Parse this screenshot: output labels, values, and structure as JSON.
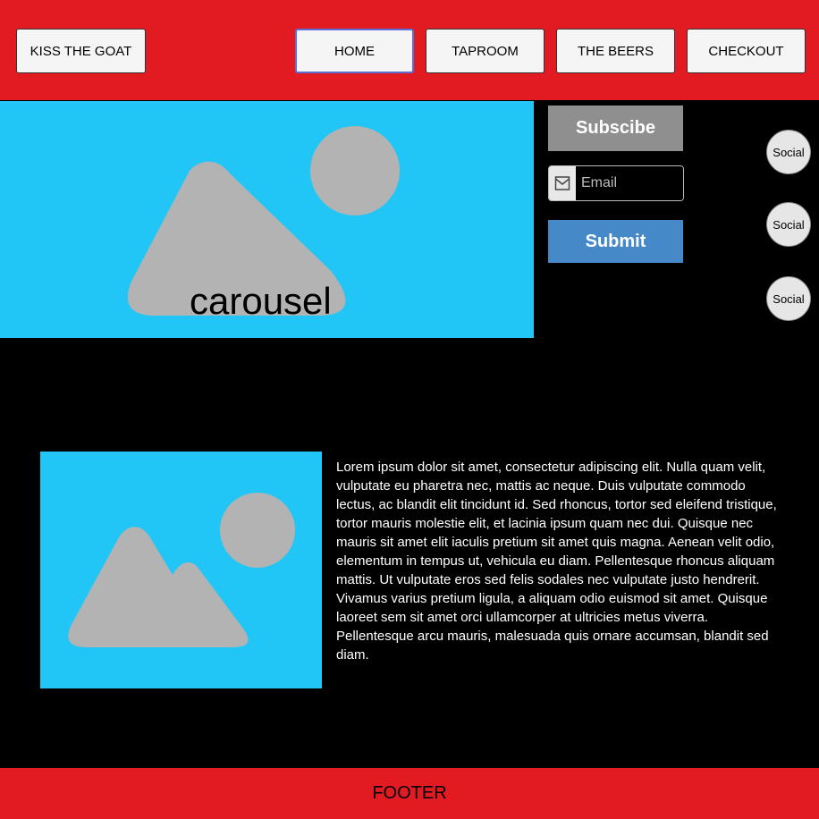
{
  "header": {
    "brand_label": "KISS THE GOAT",
    "nav": [
      {
        "label": "HOME"
      },
      {
        "label": "TAPROOM"
      },
      {
        "label": "THE BEERS"
      },
      {
        "label": "CHECKOUT"
      }
    ]
  },
  "carousel": {
    "label": "carousel"
  },
  "subscribe": {
    "title": "Subscibe",
    "email_placeholder": "Email",
    "submit_label": "Submit"
  },
  "social": [
    {
      "label": "Social"
    },
    {
      "label": "Social"
    },
    {
      "label": "Social"
    }
  ],
  "content": {
    "body": "Lorem ipsum dolor sit amet, consectetur adipiscing elit. Nulla quam velit, vulputate eu pharetra nec, mattis ac neque. Duis vulputate commodo lectus, ac blandit elit tincidunt id. Sed rhoncus, tortor sed eleifend tristique, tortor mauris molestie elit, et lacinia ipsum quam nec dui. Quisque nec mauris sit amet elit iaculis pretium sit amet quis magna. Aenean velit odio, elementum in tempus ut, vehicula eu diam. Pellentesque rhoncus aliquam mattis. Ut vulputate eros sed felis sodales nec vulputate justo hendrerit. Vivamus varius pretium ligula, a aliquam odio euismod sit amet. Quisque laoreet sem sit amet orci ullamcorper at ultricies metus viverra. Pellentesque arcu mauris, malesuada quis ornare accumsan, blandit sed diam."
  },
  "footer": {
    "label": "FOOTER"
  },
  "colors": {
    "header_bg": "#e21b23",
    "image_placeholder_bg": "#22c6f6",
    "placeholder_shape": "#b3b3b3",
    "submit_bg": "#4589c8",
    "subscribe_bg": "#8f8f8f",
    "active_nav_border": "#5a6fd6"
  }
}
